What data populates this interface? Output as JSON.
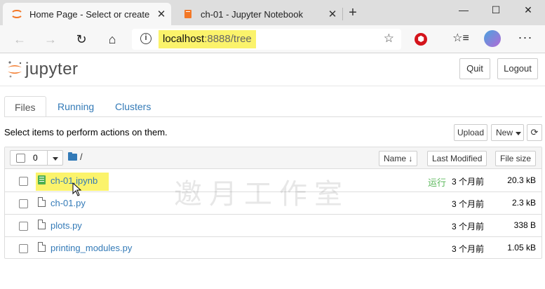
{
  "browser": {
    "tabs": [
      {
        "title": "Home Page - Select or create a n",
        "active": true,
        "icon": "jupyter-icon"
      },
      {
        "title": "ch-01 - Jupyter Notebook",
        "active": false,
        "icon": "notebook-icon"
      }
    ],
    "close_glyph": "✕",
    "new_tab_glyph": "+",
    "window_controls": {
      "minimize": "—",
      "maximize": "☐",
      "close": "✕"
    },
    "nav": {
      "back": "←",
      "forward": "→",
      "reload": "↻",
      "home": "⌂"
    },
    "address": {
      "host": "localhost",
      "rest": ":8888/tree"
    },
    "star_glyph": "☆",
    "more_glyph": "···"
  },
  "jupyter": {
    "logo_text": "jupyter",
    "quit_label": "Quit",
    "logout_label": "Logout",
    "tabs": [
      "Files",
      "Running",
      "Clusters"
    ],
    "select_text": "Select items to perform actions on them.",
    "upload_label": "Upload",
    "new_label": "New",
    "refresh_glyph": "⟳",
    "selected_count": "0",
    "path": "/",
    "columns": {
      "name": "Name ↓",
      "modified": "Last Modified",
      "size": "File size"
    },
    "files": [
      {
        "name": "ch-01.ipynb",
        "type": "notebook",
        "running": "运行",
        "modified": "3 个月前",
        "size": "20.3 kB"
      },
      {
        "name": "ch-01.py",
        "type": "file",
        "running": "",
        "modified": "3 个月前",
        "size": "2.3 kB"
      },
      {
        "name": "plots.py",
        "type": "file",
        "running": "",
        "modified": "3 个月前",
        "size": "338 B"
      },
      {
        "name": "printing_modules.py",
        "type": "file",
        "running": "",
        "modified": "3 个月前",
        "size": "1.05 kB"
      }
    ],
    "watermark": "邀月工作室"
  }
}
